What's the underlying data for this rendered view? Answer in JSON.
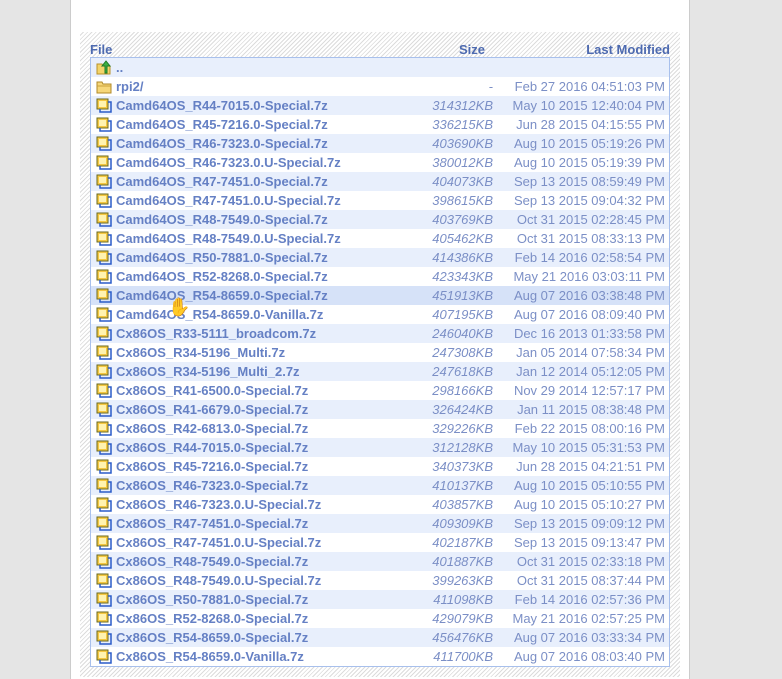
{
  "header": {
    "file": "File",
    "size": "Size",
    "modified": "Last Modified"
  },
  "rows": [
    {
      "name": "..",
      "size": "",
      "date": "",
      "icon": "parent-folder"
    },
    {
      "name": "rpi2/",
      "size": "-",
      "date": "Feb 27 2016 04:51:03 PM",
      "icon": "folder"
    },
    {
      "name": "Camd64OS_R44-7015.0-Special.7z",
      "size": "314312KB",
      "date": "May 10 2015 12:40:04 PM",
      "icon": "archive"
    },
    {
      "name": "Camd64OS_R45-7216.0-Special.7z",
      "size": "336215KB",
      "date": "Jun 28 2015 04:15:55 PM",
      "icon": "archive"
    },
    {
      "name": "Camd64OS_R46-7323.0-Special.7z",
      "size": "403690KB",
      "date": "Aug 10 2015 05:19:26 PM",
      "icon": "archive"
    },
    {
      "name": "Camd64OS_R46-7323.0.U-Special.7z",
      "size": "380012KB",
      "date": "Aug 10 2015 05:19:39 PM",
      "icon": "archive"
    },
    {
      "name": "Camd64OS_R47-7451.0-Special.7z",
      "size": "404073KB",
      "date": "Sep 13 2015 08:59:49 PM",
      "icon": "archive"
    },
    {
      "name": "Camd64OS_R47-7451.0.U-Special.7z",
      "size": "398615KB",
      "date": "Sep 13 2015 09:04:32 PM",
      "icon": "archive"
    },
    {
      "name": "Camd64OS_R48-7549.0-Special.7z",
      "size": "403769KB",
      "date": "Oct 31 2015 02:28:45 PM",
      "icon": "archive"
    },
    {
      "name": "Camd64OS_R48-7549.0.U-Special.7z",
      "size": "405462KB",
      "date": "Oct 31 2015 08:33:13 PM",
      "icon": "archive"
    },
    {
      "name": "Camd64OS_R50-7881.0-Special.7z",
      "size": "414386KB",
      "date": "Feb 14 2016 02:58:54 PM",
      "icon": "archive"
    },
    {
      "name": "Camd64OS_R52-8268.0-Special.7z",
      "size": "423343KB",
      "date": "May 21 2016 03:03:11 PM",
      "icon": "archive"
    },
    {
      "name": "Camd64OS_R54-8659.0-Special.7z",
      "size": "451913KB",
      "date": "Aug 07 2016 03:38:48 PM",
      "icon": "archive"
    },
    {
      "name": "Camd64OS_R54-8659.0-Vanilla.7z",
      "size": "407195KB",
      "date": "Aug 07 2016 08:09:40 PM",
      "icon": "archive"
    },
    {
      "name": "Cx86OS_R33-5111_broadcom.7z",
      "size": "246040KB",
      "date": "Dec 16 2013 01:33:58 PM",
      "icon": "archive"
    },
    {
      "name": "Cx86OS_R34-5196_Multi.7z",
      "size": "247308KB",
      "date": "Jan 05 2014 07:58:34 PM",
      "icon": "archive"
    },
    {
      "name": "Cx86OS_R34-5196_Multi_2.7z",
      "size": "247618KB",
      "date": "Jan 12 2014 05:12:05 PM",
      "icon": "archive"
    },
    {
      "name": "Cx86OS_R41-6500.0-Special.7z",
      "size": "298166KB",
      "date": "Nov 29 2014 12:57:17 PM",
      "icon": "archive"
    },
    {
      "name": "Cx86OS_R41-6679.0-Special.7z",
      "size": "326424KB",
      "date": "Jan 11 2015 08:38:48 PM",
      "icon": "archive"
    },
    {
      "name": "Cx86OS_R42-6813.0-Special.7z",
      "size": "329226KB",
      "date": "Feb 22 2015 08:00:16 PM",
      "icon": "archive"
    },
    {
      "name": "Cx86OS_R44-7015.0-Special.7z",
      "size": "312128KB",
      "date": "May 10 2015 05:31:53 PM",
      "icon": "archive"
    },
    {
      "name": "Cx86OS_R45-7216.0-Special.7z",
      "size": "340373KB",
      "date": "Jun 28 2015 04:21:51 PM",
      "icon": "archive"
    },
    {
      "name": "Cx86OS_R46-7323.0-Special.7z",
      "size": "410137KB",
      "date": "Aug 10 2015 05:10:55 PM",
      "icon": "archive"
    },
    {
      "name": "Cx86OS_R46-7323.0.U-Special.7z",
      "size": "403857KB",
      "date": "Aug 10 2015 05:10:27 PM",
      "icon": "archive"
    },
    {
      "name": "Cx86OS_R47-7451.0-Special.7z",
      "size": "409309KB",
      "date": "Sep 13 2015 09:09:12 PM",
      "icon": "archive"
    },
    {
      "name": "Cx86OS_R47-7451.0.U-Special.7z",
      "size": "402187KB",
      "date": "Sep 13 2015 09:13:47 PM",
      "icon": "archive"
    },
    {
      "name": "Cx86OS_R48-7549.0-Special.7z",
      "size": "401887KB",
      "date": "Oct 31 2015 02:33:18 PM",
      "icon": "archive"
    },
    {
      "name": "Cx86OS_R48-7549.0.U-Special.7z",
      "size": "399263KB",
      "date": "Oct 31 2015 08:37:44 PM",
      "icon": "archive"
    },
    {
      "name": "Cx86OS_R50-7881.0-Special.7z",
      "size": "411098KB",
      "date": "Feb 14 2016 02:57:36 PM",
      "icon": "archive"
    },
    {
      "name": "Cx86OS_R52-8268.0-Special.7z",
      "size": "429079KB",
      "date": "May 21 2016 02:57:25 PM",
      "icon": "archive"
    },
    {
      "name": "Cx86OS_R54-8659.0-Special.7z",
      "size": "456476KB",
      "date": "Aug 07 2016 03:33:34 PM",
      "icon": "archive"
    },
    {
      "name": "Cx86OS_R54-8659.0-Vanilla.7z",
      "size": "411700KB",
      "date": "Aug 07 2016 08:03:40 PM",
      "icon": "archive"
    }
  ],
  "hovered_row": 12
}
